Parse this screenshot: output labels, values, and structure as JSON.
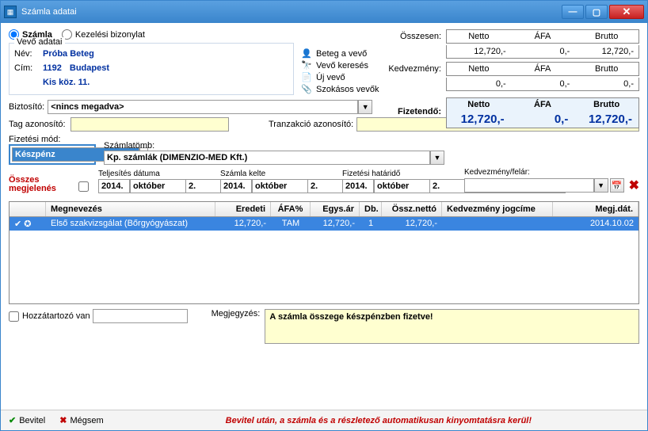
{
  "window": {
    "title": "Számla adatai"
  },
  "mode": {
    "invoice_label": "Számla",
    "treatment_label": "Kezelési bizonylat"
  },
  "customer": {
    "legend": "Vevő adatai",
    "name_label": "Név:",
    "name": "Próba Beteg",
    "addr_label": "Cím:",
    "zip": "1192",
    "city": "Budapest",
    "street": "Kis köz. 11."
  },
  "actions": {
    "patient_is_customer": "Beteg a vevő",
    "search_customer": "Vevő keresés",
    "new_customer": "Új vevő",
    "usual_customers": "Szokásos vevők"
  },
  "totals": {
    "sum_label": "Összesen:",
    "discount_label": "Kedvezmény:",
    "payable_label": "Fizetendő:",
    "head_netto": "Netto",
    "head_afa": "ÁFA",
    "head_brutto": "Brutto",
    "sum": {
      "netto": "12,720,-",
      "afa": "0,-",
      "brutto": "12,720,-"
    },
    "discount": {
      "netto": "0,-",
      "afa": "0,-",
      "brutto": "0,-"
    },
    "payable": {
      "netto": "12,720,-",
      "afa": "0,-",
      "brutto": "12,720,-"
    }
  },
  "insurer": {
    "label": "Biztosító:",
    "value": "<nincs megadva>"
  },
  "tag": {
    "label": "Tag azonosító:",
    "value": ""
  },
  "txn": {
    "label": "Tranzakció azonosító:",
    "value": ""
  },
  "paymethod": {
    "label": "Fizetési mód:",
    "value": "Készpénz"
  },
  "book": {
    "label": "Számlatömb:",
    "value": "Kp. számlák (DIMENZIO-MED Kft.)"
  },
  "all_display": {
    "line1": "Összes",
    "line2": "megjelenés"
  },
  "dates": {
    "fulfill_label": "Teljesítés dátuma",
    "issue_label": "Számla kelte",
    "due_label": "Fizetési határidő",
    "year": "2014.",
    "month": "október",
    "day": "2."
  },
  "surcharge": {
    "label": "Kedvezmény/felár:",
    "value": ""
  },
  "grid": {
    "head": {
      "name": "Megnevezés",
      "orig": "Eredeti",
      "vat": "ÁFA%",
      "unit": "Egys.ár",
      "qty": "Db.",
      "net": "Össz.nettó",
      "disc_title": "Kedvezmény jogcíme",
      "date": "Megj.dát."
    },
    "rows": [
      {
        "name": "Első szakvizsgálat (Bőrgyógyászat)",
        "orig": "12,720,-",
        "vat": "TAM",
        "unit": "12,720,-",
        "qty": "1",
        "net": "12,720,-",
        "disc": "",
        "date": "2014.10.02"
      }
    ]
  },
  "related": {
    "label": "Hozzátartozó van"
  },
  "note": {
    "label": "Megjegyzés:",
    "text": "A számla összege készpénzben fizetve!"
  },
  "footer": {
    "ok": "Bevitel",
    "cancel": "Mégsem",
    "msg": "Bevitel után, a számla és a részletező automatikusan kinyomtatásra kerül!"
  }
}
